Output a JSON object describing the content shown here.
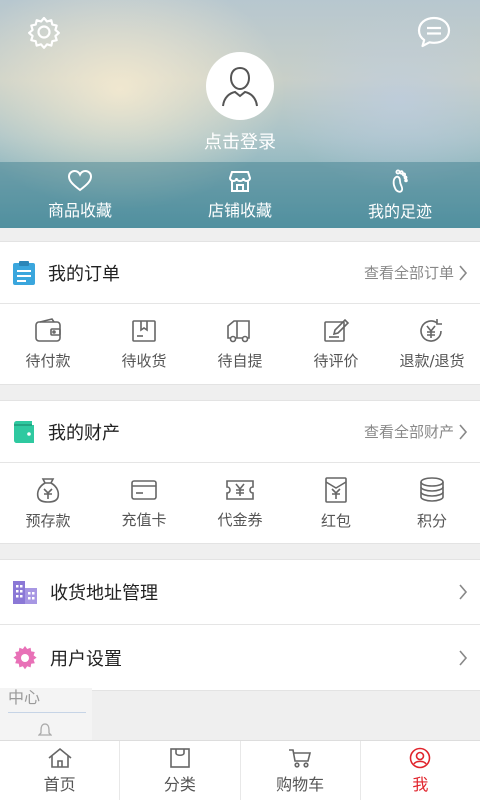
{
  "header": {
    "login_text": "点击登录",
    "quick_links": [
      {
        "label": "商品收藏",
        "icon": "heart-icon"
      },
      {
        "label": "店铺收藏",
        "icon": "store-icon"
      },
      {
        "label": "我的足迹",
        "icon": "footprint-icon"
      }
    ]
  },
  "orders": {
    "title": "我的订单",
    "more": "查看全部订单",
    "items": [
      {
        "label": "待付款",
        "icon": "wallet-icon"
      },
      {
        "label": "待收货",
        "icon": "package-icon"
      },
      {
        "label": "待自提",
        "icon": "truck-icon"
      },
      {
        "label": "待评价",
        "icon": "edit-icon"
      },
      {
        "label": "退款/退货",
        "icon": "refund-icon"
      }
    ]
  },
  "assets": {
    "title": "我的财产",
    "more": "查看全部财产",
    "items": [
      {
        "label": "预存款",
        "icon": "money-bag-icon"
      },
      {
        "label": "充值卡",
        "icon": "card-icon"
      },
      {
        "label": "代金券",
        "icon": "voucher-icon"
      },
      {
        "label": "红包",
        "icon": "red-packet-icon"
      },
      {
        "label": "积分",
        "icon": "coins-icon"
      }
    ]
  },
  "rows": {
    "address": "收货地址管理",
    "settings": "用户设置"
  },
  "remnant_text": "中心",
  "tabs": [
    {
      "label": "首页",
      "icon": "home-icon"
    },
    {
      "label": "分类",
      "icon": "bag-icon"
    },
    {
      "label": "购物车",
      "icon": "cart-icon"
    },
    {
      "label": "我",
      "icon": "user-icon"
    }
  ],
  "colors": {
    "accent_red": "#e0242c",
    "order_icon": "#3aa6dd",
    "asset_icon": "#2fc9a0",
    "address_icon": "#8b78d6",
    "settings_icon": "#e871b7"
  }
}
